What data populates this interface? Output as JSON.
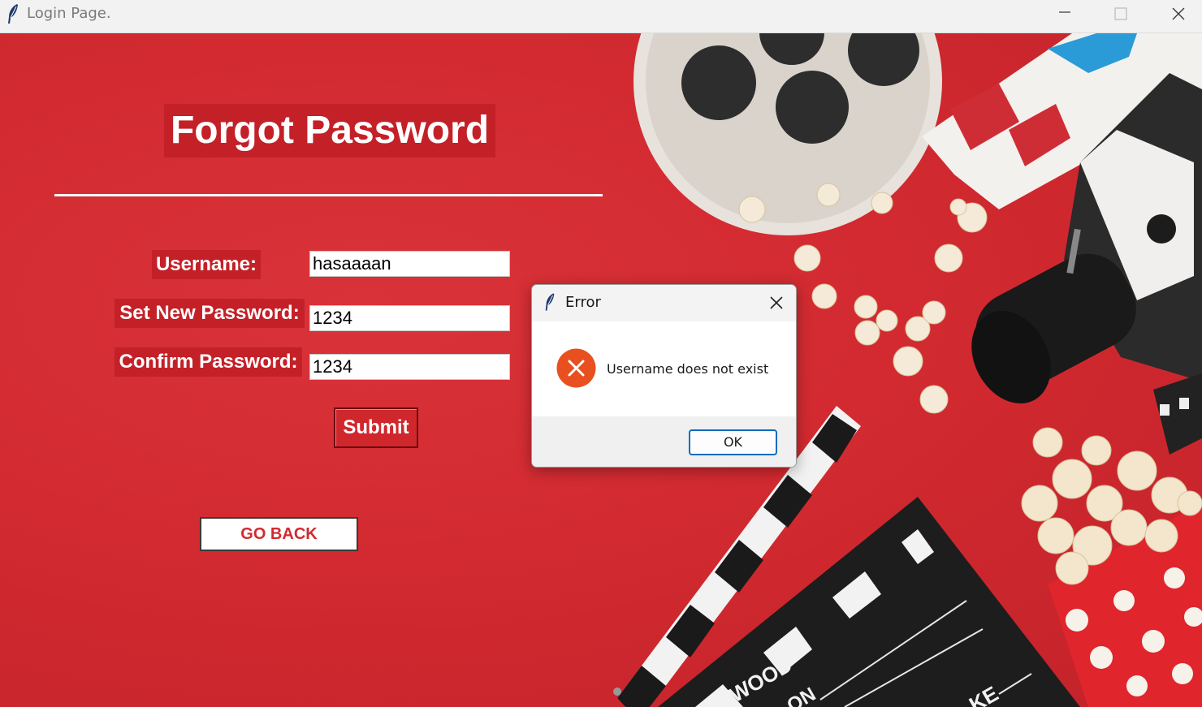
{
  "window": {
    "title": "Login Page."
  },
  "form": {
    "heading": "Forgot Password",
    "username_label": "Username:",
    "username_value": "hasaaaan",
    "new_password_label": "Set New Password:",
    "new_password_value": "1234",
    "confirm_password_label": "Confirm Password:",
    "confirm_password_value": "1234",
    "submit_label": "Submit",
    "go_back_label": "GO BACK"
  },
  "dialog": {
    "title": "Error",
    "message": "Username does not exist",
    "ok_label": "OK"
  },
  "background": {
    "clapper_text_1": "WOOD",
    "clapper_text_2": "ON",
    "clapper_text_3": "KE"
  },
  "colors": {
    "background_red": "#d52a2f",
    "label_red": "#c42027",
    "error_orange": "#e8501f",
    "dialog_focus_blue": "#0f6cbd"
  },
  "icons": {
    "app": "feather-icon",
    "minimize": "minimize-icon",
    "maximize": "maximize-icon",
    "close": "close-icon",
    "error": "error-icon"
  }
}
